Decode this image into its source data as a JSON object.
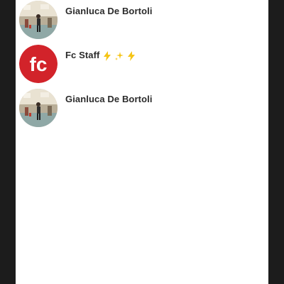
{
  "list": {
    "items": [
      {
        "name": "Gianluca De Bortoli",
        "avatar": "gym-photo-avatar"
      },
      {
        "name": "Fc Staff",
        "avatar": "fc-logo-avatar",
        "avatar_text": "fc",
        "avatar_color": "#d2232a",
        "emojis": [
          "lightning-icon",
          "sparkles-icon",
          "lightning-icon"
        ]
      },
      {
        "name": "Gianluca De Bortoli",
        "avatar": "gym-photo-avatar"
      }
    ]
  },
  "colors": {
    "background": "#1c1c1c",
    "screen": "#ffffff",
    "text": "#2b2b2b",
    "brand_red": "#d2232a",
    "emoji_yellow": "#f5c518"
  }
}
